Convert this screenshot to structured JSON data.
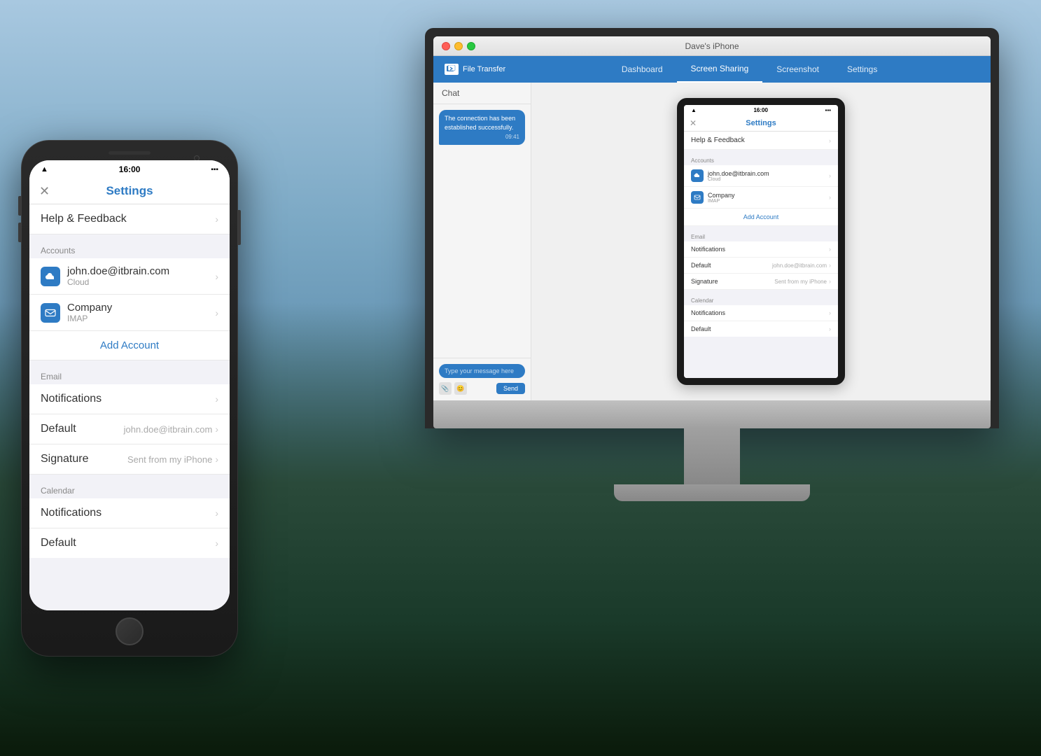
{
  "background": {
    "colors": [
      "#a8c8e0",
      "#5a8aaa",
      "#3a6a8a",
      "#1a3a2a"
    ]
  },
  "monitor": {
    "title": "Dave's iPhone",
    "nav": {
      "logo": "File Transfer",
      "items": [
        "Dashboard",
        "Screen Sharing",
        "Screenshot",
        "Settings"
      ],
      "active": "Screen Sharing"
    },
    "chat": {
      "header": "Chat",
      "message": "The connection has been established successfully.",
      "time": "09:41",
      "input_placeholder": "Type your message here",
      "send_label": "Send"
    }
  },
  "settings": {
    "title": "Settings",
    "status_time": "16:00",
    "help_feedback": "Help & Feedback",
    "sections": {
      "accounts": {
        "label": "Accounts",
        "items": [
          {
            "name": "john.doe@itbrain.com",
            "type": "Cloud",
            "icon": "cloud"
          },
          {
            "name": "Company",
            "type": "IMAP",
            "icon": "mail"
          }
        ],
        "add_account": "Add Account"
      },
      "email": {
        "label": "Email",
        "items": [
          {
            "name": "Notifications",
            "value": ""
          },
          {
            "name": "Default",
            "value": "john.doe@itbrain.com"
          },
          {
            "name": "Signature",
            "value": "Sent from my iPhone"
          }
        ]
      },
      "calendar": {
        "label": "Calendar",
        "items": [
          {
            "name": "Notifications",
            "value": ""
          },
          {
            "name": "Default",
            "value": ""
          }
        ]
      }
    }
  },
  "phone": {
    "status_time": "16:00",
    "settings_title": "Settings",
    "help_feedback": "Help & Feedback",
    "accounts_label": "Accounts",
    "accounts": [
      {
        "name": "john.doe@itbrain.com",
        "type": "Cloud"
      },
      {
        "name": "Company",
        "type": "IMAP"
      }
    ],
    "add_account": "Add Account",
    "email_label": "Email",
    "notifications_label": "Notifications",
    "default_label": "Default",
    "default_value": "john.doe@itbrain.com",
    "signature_label": "Signature",
    "signature_value": "Sent from my iPhone",
    "calendar_label": "Calendar",
    "calendar_notifications": "Notifications",
    "calendar_default": "Default"
  }
}
